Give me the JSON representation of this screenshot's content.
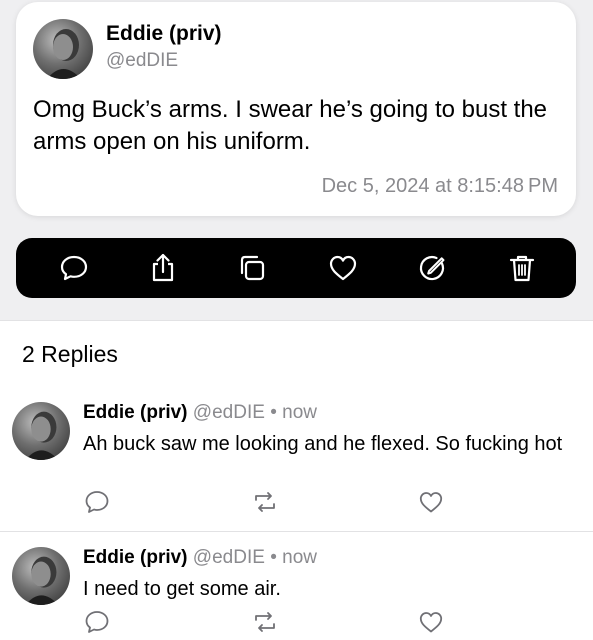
{
  "post": {
    "author_name": "Eddie (priv)",
    "author_handle": "@edDIE",
    "text": "Omg Buck’s arms. I swear he’s going to bust the arms open on his uniform.",
    "timestamp": "Dec 5, 2024 at 8:15:48 PM"
  },
  "action_bar": {
    "icons": [
      "reply-icon",
      "share-icon",
      "copy-icon",
      "like-icon",
      "edit-icon",
      "delete-icon"
    ],
    "background": "#000000",
    "icon_color": "#ffffff"
  },
  "replies": {
    "count_label": "2 Replies",
    "items": [
      {
        "author_name": "Eddie (priv)",
        "author_handle": "@edDIE",
        "separator": "•",
        "time": "now",
        "text": "Ah buck saw me looking and he flexed. So fucking hot"
      },
      {
        "author_name": "Eddie (priv)",
        "author_handle": "@edDIE",
        "separator": "•",
        "time": "now",
        "text": "I need to get some air."
      }
    ]
  },
  "colors": {
    "secondary_text": "#8a8a8e",
    "page_background": "#efeff1",
    "divider": "#e2e2e4"
  }
}
